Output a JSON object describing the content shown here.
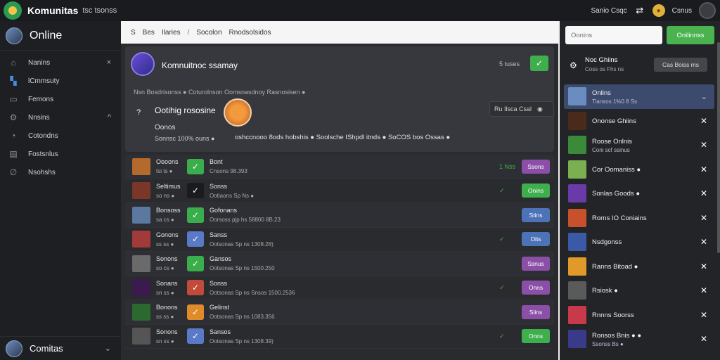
{
  "app": {
    "title": "Komunitas",
    "subtitle": "tsc tsonss"
  },
  "topbar": {
    "link": "Sanio Csqc",
    "link_icon": "swap-icon",
    "coin_label": "Csnus"
  },
  "sidebar": {
    "user": "Online",
    "items": [
      {
        "label": "Nanins",
        "icon": "home-icon",
        "chevron": "×"
      },
      {
        "label": "lCmmsuty",
        "icon": "community-icon"
      },
      {
        "label": "Femons",
        "icon": "friends-icon"
      },
      {
        "label": "Nnsins",
        "icon": "settings-icon",
        "chevron": "^"
      },
      {
        "label": "Cotondns",
        "icon": "chat-icon"
      },
      {
        "label": "Fostsnlus",
        "icon": "list-icon"
      },
      {
        "label": "Nsohshs",
        "icon": "link-icon"
      }
    ],
    "bottom_user": "Comitas"
  },
  "breadcrumb": [
    "S",
    "Bes",
    "Ilaries",
    "/",
    "Socolon",
    "Rnodsolsidos"
  ],
  "hero": {
    "title": "Komnuitnoc ssamay",
    "count": "5 tuses",
    "status": "Nsn Bosdrisonss ● Coturolnson Oomsnasdnoy Rasnosisen ●",
    "heading": "Ootihig rososine",
    "sub1": "Oonos",
    "sub2": "Sonnsc 100% ouns ●",
    "desc": "oshccnooo 8ods hobshis ● Soolsche IShpdl itnds ● SoCOS bos Ossas ●",
    "live": "Ru Ilsca Csal"
  },
  "rows": [
    {
      "name": "Oooons",
      "meta": "tsi ts ●",
      "title": "Bont",
      "sub": "Cnsons 98.393",
      "tag": "1 Nss",
      "btn": "Ssons",
      "btn_color": "#8b4fa8",
      "icon_color": "#3aae4a",
      "av": "#b46a2c"
    },
    {
      "name": "Seltimus",
      "meta": "so ns ●",
      "title": "Sonss",
      "sub": "Ootiaons Sp Ns ●",
      "tag": "✓",
      "btn": "Onins",
      "btn_color": "#3fae4c",
      "icon_color": "#1a1b1e",
      "av": "#7a3628"
    },
    {
      "name": "Bonsoss",
      "meta": "sa cs ●",
      "title": "Gofonans",
      "sub": "Oorsoss pjp hs 58800 8B.23",
      "tag": "",
      "btn": "Stins",
      "btn_color": "#4c72b8",
      "icon_color": "#3aae4a",
      "av": "#5b78a0"
    },
    {
      "name": "Gonons",
      "meta": "ss ss ●",
      "title": "Sanss",
      "sub": "Ootsonas Sp ns 1308.28)",
      "tag": "✓",
      "btn": "Oits",
      "btn_color": "#4c72b8",
      "icon_color": "#5a7ac8",
      "av": "#a33a3a"
    },
    {
      "name": "Sonons",
      "meta": "so cs ●",
      "title": "Gansos",
      "sub": "Ootsonas Sp ns 1500.250",
      "tag": "",
      "btn": "Ssnus",
      "btn_color": "#8b4fa8",
      "icon_color": "#3aae4a",
      "av": "#6a6a6a"
    },
    {
      "name": "Sonans",
      "meta": "sn ss ●",
      "title": "Sonss",
      "sub": "Ootsonas Sp ns Snsos 1500.2536",
      "tag": "✓",
      "btn": "Onns",
      "btn_color": "#8b4fa8",
      "icon_color": "#c24a3a",
      "av": "#3b1a4e"
    },
    {
      "name": "Bonons",
      "meta": "ss ss ●",
      "title": "Gelinst",
      "sub": "Ootsonas Sp ns 1083.356",
      "tag": "",
      "btn": "Siins",
      "btn_color": "#8b4fa8",
      "icon_color": "#e08a2a",
      "av": "#2b6a2e"
    },
    {
      "name": "Sonons",
      "meta": "sn ss ●",
      "title": "Sansos",
      "sub": "Ootsonas Sp ns 1308.39)",
      "tag": "✓",
      "btn": "Onns",
      "btn_color": "#3fae4c",
      "icon_color": "#5a7ac8",
      "av": "#555"
    }
  ],
  "right": {
    "search_placeholder": "Oonins",
    "go": "Onilinnss",
    "toolbar_title": "Noc Ghiins",
    "toolbar_sub": "Coss os Fhs ns",
    "toolbar_btn": "Cas Boiss ms",
    "items": [
      {
        "name": "Onlins",
        "sub": "Tiansos 1%0 8 Ss",
        "active": true,
        "av": "#6b8cbf"
      },
      {
        "name": "Ononse Ghiins",
        "sub": "",
        "av": "#4a2a1a"
      },
      {
        "name": "Roose Onlnis",
        "sub": "Coni scf ssinus",
        "av": "#3a8a3a"
      },
      {
        "name": "Cor Oomaniss ●",
        "sub": "",
        "av": "#7ab050"
      },
      {
        "name": "Sonlas Goods ●",
        "sub": "",
        "av": "#6a3aa8"
      },
      {
        "name": "Rorns IO Coniains",
        "sub": "",
        "av": "#c8502a"
      },
      {
        "name": "Nsdgonss",
        "sub": "",
        "av": "#3a5aa8"
      },
      {
        "name": "Ranns Bitoad ●",
        "sub": "",
        "av": "#e09a2a"
      },
      {
        "name": "Rsiosk ●",
        "sub": "",
        "av": "#5a5a5a"
      },
      {
        "name": "Rnnns Soorss",
        "sub": "",
        "av": "#c83a4a"
      },
      {
        "name": "Ronsos Bnis ● ●",
        "sub": "Ssonss Bs ●",
        "av": "#3a3a8a"
      }
    ]
  }
}
